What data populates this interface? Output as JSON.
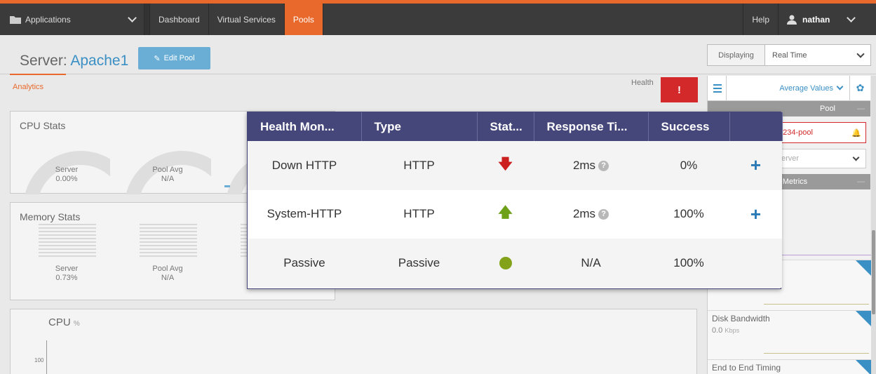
{
  "nav": {
    "applications": "Applications",
    "dashboard": "Dashboard",
    "virtual_services": "Virtual Services",
    "pools": "Pools",
    "help": "Help",
    "user": "nathan",
    "accent_color": "#e9692c"
  },
  "header": {
    "server_prefix": "Server:",
    "server_name": "Apache1",
    "edit_button": "Edit Pool",
    "displaying_label": "Displaying",
    "displaying_value": "Real Time"
  },
  "tabs": {
    "analytics": "Analytics"
  },
  "health": {
    "label": "Health",
    "alert": "!",
    "alert_color": "#d3292b"
  },
  "cpu_stats": {
    "title": "CPU Stats",
    "server_label": "Server",
    "server_value": "0.00%",
    "pool_avg_label": "Pool Avg",
    "pool_avg_value": "N/A"
  },
  "memory_stats": {
    "title": "Memory Stats",
    "server_label": "Server",
    "server_value": "0.73%",
    "pool_avg_label": "Pool Avg",
    "pool_avg_value": "N/A"
  },
  "cpu_chart": {
    "title": "CPU",
    "unit": "%",
    "tick": "100"
  },
  "sidebar": {
    "average_values": "Average Values",
    "pool_section": "Pool",
    "pool_name": "1234-pool",
    "server_placeholder": "erver",
    "metrics_section": "r Metrics",
    "disk_bandwidth": "Disk Bandwidth",
    "disk_value": "0.0",
    "disk_unit": "Kbps",
    "end_to_end": "End to End Timing"
  },
  "health_table": {
    "columns": [
      "Health Mon...",
      "Type",
      "Stat...",
      "Response Ti...",
      "Success",
      ""
    ],
    "rows": [
      {
        "monitor": "Down HTTP",
        "type": "HTTP",
        "status": "down",
        "response": "2ms",
        "success": "0%",
        "action": "+"
      },
      {
        "monitor": "System-HTTP",
        "type": "HTTP",
        "status": "up",
        "response": "2ms",
        "success": "100%",
        "action": "+"
      },
      {
        "monitor": "Passive",
        "type": "Passive",
        "status": "ok",
        "response": "N/A",
        "success": "100%",
        "action": ""
      }
    ],
    "header_color": "#45477a"
  }
}
